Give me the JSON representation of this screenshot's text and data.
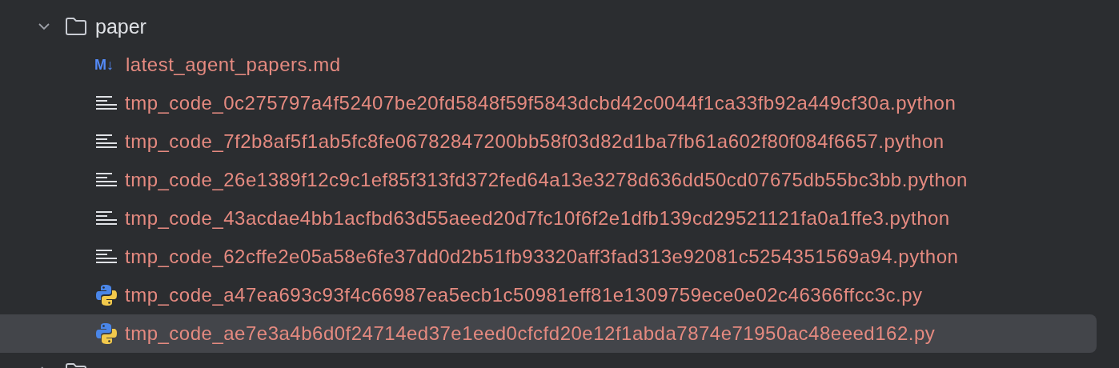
{
  "tree": [
    {
      "kind": "folder",
      "name": "paper",
      "expanded": true,
      "selected": false,
      "children": [
        {
          "kind": "markdown",
          "badge": "M↓",
          "name": "latest_agent_papers.md",
          "selected": false
        },
        {
          "kind": "text",
          "name": "tmp_code_0c275797a4f52407be20fd5848f59f5843dcbd42c0044f1ca33fb92a449cf30a.python",
          "selected": false
        },
        {
          "kind": "text",
          "name": "tmp_code_7f2b8af5f1ab5fc8fe06782847200bb58f03d82d1ba7fb61a602f80f084f6657.python",
          "selected": false
        },
        {
          "kind": "text",
          "name": "tmp_code_26e1389f12c9c1ef85f313fd372fed64a13e3278d636dd50cd07675db55bc3bb.python",
          "selected": false
        },
        {
          "kind": "text",
          "name": "tmp_code_43acdae4bb1acfbd63d55aeed20d7fc10f6f2e1dfb139cd29521121fa0a1ffe3.python",
          "selected": false
        },
        {
          "kind": "text",
          "name": "tmp_code_62cffe2e05a58e6fe37dd0d2b51fb93320aff3fad313e92081c5254351569a94.python",
          "selected": false
        },
        {
          "kind": "python",
          "name": "tmp_code_a47ea693c93f4c66987ea5ecb1c50981eff81e1309759ece0e02c46366ffcc3c.py",
          "selected": false
        },
        {
          "kind": "python",
          "name": "tmp_code_ae7e3a4b6d0f24714ed37e1eed0cfcfd20e12f1abda7874e71950ac48eeed162.py",
          "selected": true
        }
      ]
    },
    {
      "kind": "folder",
      "expanded": false,
      "selected": false
    }
  ]
}
